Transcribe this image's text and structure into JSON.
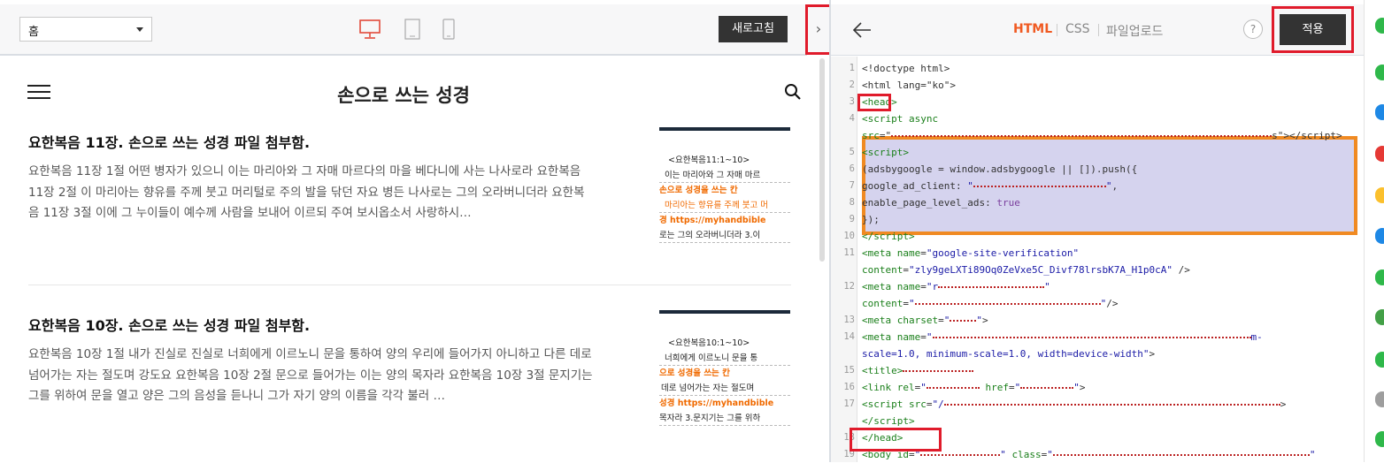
{
  "left_toolbar": {
    "page_select_value": "홈",
    "refresh_label": "새로고침",
    "toggle_symbol": "›"
  },
  "blog": {
    "title": "손으로 쓰는 성경"
  },
  "posts": [
    {
      "title": "요한복음 11장. 손으로 쓰는 성경 파일 첨부함.",
      "excerpt": "요한복음 11장 1절 어떤 병자가 있으니 이는 마리아와 그 자매 마르다의 마을 베다니에 사는 나사로라 요한복음 11장 2절 이 마리아는 향유를 주께 붓고 머리털로 주의 발을 닦던 자요 병든 나사로는 그의 오라버니더라 요한복음 11장 3절 이에 그 누이들이 예수께 사람을 보내어 이르되 주여 보시옵소서 사랑하시…",
      "thumb_lines": [
        "<요한복음11:1~10>",
        "이는 마리아와 그 자매 마르",
        "손으로 성경을 쓰는 칸",
        "마리아는 향유를 주께 붓고 머",
        "경        https://myhandbible",
        "로는 그의 오라버니더라  3.이"
      ]
    },
    {
      "title": "요한복음 10장. 손으로 쓰는 성경 파일 첨부함.",
      "excerpt": "요한복음 10장 1절 내가 진실로 진실로 너희에게 이르노니 문을 통하여 양의 우리에 들어가지 아니하고 다른 데로 넘어가는 자는 절도며 강도요 요한복음 10장 2절 문으로 들어가는 이는 양의 목자라 요한복음 10장 3절 문지기는 그를 위하여 문을 열고 양은 그의 음성을 듣나니 그가 자기 양의 이름을 각각 불러 …",
      "thumb_lines": [
        "<요한복음10:1~10>",
        "너희에게 이르노니 문을 통",
        "으로 성경을 쓰는 칸",
        "데로 넘어가는 자는 절도며",
        "성경   https://myhandbible",
        "목자라  3.문지기는 그를 위하"
      ]
    }
  ],
  "editor": {
    "tabs": [
      "HTML",
      "CSS",
      "파일업로드"
    ],
    "help_label": "?",
    "apply_label": "적용",
    "lines": [
      {
        "n": "1",
        "html": "&lt;!doctype html&gt;"
      },
      {
        "n": "2",
        "html": "&lt;html lang=\"ko\"&gt;"
      },
      {
        "n": "3",
        "html": "<span class='tag'>&lt;head&gt;</span>"
      },
      {
        "n": "4",
        "html": "  <span class='tag'>&lt;script</span> <span class='attr'>async</span>"
      },
      {
        "n": "",
        "html": "<span class='attr'>src</span>=\"<span class='scribble' style='width:430px'></span>s\"&gt;&lt;/script&gt;"
      },
      {
        "n": "5",
        "html": "<span class='tag'>&lt;script&gt;</span>"
      },
      {
        "n": "6",
        "html": "      (adsbygoogle = window.adsbygoogle || []).push({"
      },
      {
        "n": "7",
        "html": "           google_ad_client: <span class='str'>\"<span class='scribble' style='width:150px'></span>\"</span>,"
      },
      {
        "n": "8",
        "html": "           enable_page_level_ads: <span class='kw'>true</span>"
      },
      {
        "n": "9",
        "html": "      });"
      },
      {
        "n": "10",
        "html": "<span class='tag'>&lt;/script&gt;</span>"
      },
      {
        "n": "11",
        "html": "<span class='tag'>&lt;meta</span> <span class='attr'>name</span>=<span class='str'>\"google-site-verification\"</span>"
      },
      {
        "n": "",
        "html": "<span class='attr'>content</span>=<span class='str'>\"zly9geLXTi89Oq0ZeVxe5C_Divf78lrsbK7A_H1p0cA\"</span> /&gt;"
      },
      {
        "n": "12",
        "html": "<span class='tag'>&lt;meta</span> <span class='attr'>name</span>=<span class='str'>\"r<span class='scribble' style='width:120px'></span>\"</span>"
      },
      {
        "n": "",
        "html": "<span class='attr'>content</span>=<span class='str'>\"<span class='scribble' style='width:210px'></span>\"</span>/&gt;"
      },
      {
        "n": "13",
        "html": "<span class='tag'>&lt;meta</span> <span class='attr'>charset</span>=<span class='str'>\"<span class='scribble' style='width:30px'></span>\"</span>&gt;"
      },
      {
        "n": "14",
        "html": "<span class='tag'>&lt;meta</span> <span class='attr'>name</span>=<span class='str'>\"<span class='scribble' style='width:360px'></span>m-</span>"
      },
      {
        "n": "",
        "html": "<span class='str'>scale=1.0, minimum-scale=1.0, width=device-width\"</span>&gt;"
      },
      {
        "n": "15",
        "html": "<span class='tag'>&lt;title&gt;</span><span class='scribble' style='width:80px'></span>"
      },
      {
        "n": "16",
        "html": "<span class='tag'>&lt;link</span> <span class='attr'>rel</span>=<span class='str'>\"<span class='scribble' style='width:60px'></span></span> <span class='attr'>href</span>=<span class='str'>\"<span class='scribble' style='width:60px'></span>\"</span>&gt;"
      },
      {
        "n": "17",
        "html": "<span class='tag'>&lt;script</span> <span class='attr'>src</span>=<span class='str'>\"/<span class='scribble' style='width:380px'></span></span>&gt;"
      },
      {
        "n": "",
        "html": "<span class='tag'>&lt;/script&gt;</span>"
      },
      {
        "n": "18",
        "html": "<span class='tag'>&lt;/head&gt;</span>"
      },
      {
        "n": "19",
        "html": "<span class='tag'>&lt;body</span> <span class='attr'>id</span>=<span class='str'>\"<span class='scribble' style='width:90px'></span>\"</span> <span class='attr'>class</span>=<span class='str'>\"<span class='scribble' style='width:290px'></span>\"</span>"
      }
    ]
  },
  "colors": {
    "accent_orange": "#f05a22",
    "annotation_red": "#e01b2b",
    "annotation_orange": "#f08a22",
    "highlight_lavender": "#d5d3ee"
  }
}
